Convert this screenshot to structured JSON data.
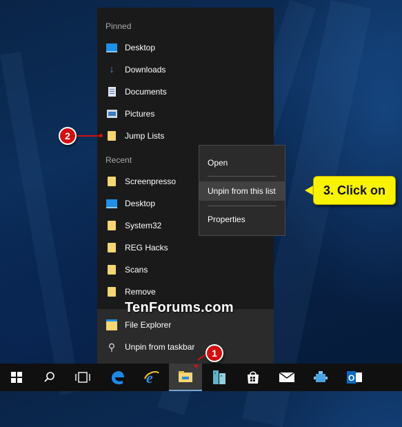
{
  "jump_list": {
    "pinned_header": "Pinned",
    "pinned": [
      {
        "label": "Desktop",
        "icon": "desktop-icon"
      },
      {
        "label": "Downloads",
        "icon": "download-arrow-icon"
      },
      {
        "label": "Documents",
        "icon": "documents-icon"
      },
      {
        "label": "Pictures",
        "icon": "pictures-icon"
      },
      {
        "label": "Jump Lists",
        "icon": "folder-icon"
      }
    ],
    "recent_header": "Recent",
    "recent": [
      {
        "label": "Screenpresso",
        "icon": "folder-icon"
      },
      {
        "label": "Desktop",
        "icon": "desktop-icon"
      },
      {
        "label": "System32",
        "icon": "folder-icon"
      },
      {
        "label": "REG Hacks",
        "icon": "folder-icon"
      },
      {
        "label": "Scans",
        "icon": "folder-icon"
      },
      {
        "label": "Remove",
        "icon": "folder-icon"
      }
    ],
    "bottom": [
      {
        "label": "File Explorer",
        "icon": "file-explorer-icon"
      },
      {
        "label": "Unpin from taskbar",
        "icon": "unpin-icon"
      }
    ]
  },
  "watermark": "TenForums.com",
  "context_menu": {
    "items": [
      "Open",
      "Unpin from this list",
      "Properties"
    ],
    "highlighted": "Unpin from this list"
  },
  "callout": {
    "text": "3. Click on",
    "color": "#f9f300"
  },
  "markers": [
    "1",
    "2"
  ],
  "taskbar": {
    "buttons": [
      "start-icon",
      "search-icon",
      "task-view-icon",
      "edge-icon",
      "internet-explorer-icon",
      "file-explorer-icon",
      "windows-accessories-icon",
      "store-icon",
      "mail-icon",
      "network-icon",
      "outlook-icon"
    ],
    "active": "file-explorer-icon"
  }
}
